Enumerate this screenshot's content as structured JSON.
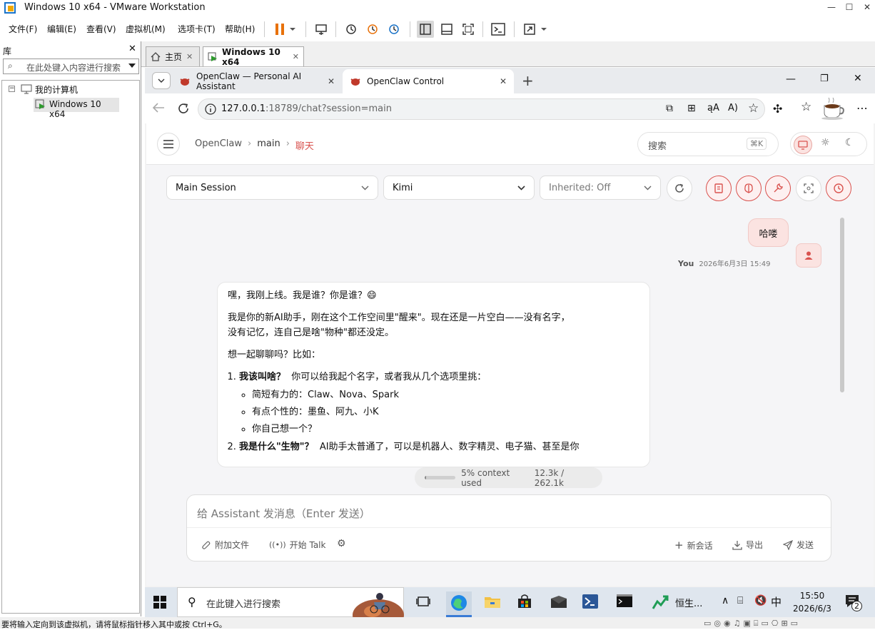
{
  "vm": {
    "title": "Windows 10 x64 - VMware Workstation",
    "menu": [
      "文件(F)",
      "编辑(E)",
      "查看(V)",
      "虚拟机(M)",
      "选项卡(T)",
      "帮助(H)"
    ],
    "library": {
      "title": "库",
      "search_placeholder": "在此处键入内容进行搜索",
      "tree_root": "我的计算机",
      "tree_child": "Windows 10 x64"
    },
    "tabs": [
      {
        "label": "主页"
      },
      {
        "label": "Windows 10 x64"
      }
    ],
    "status": "要将输入定向到该虚拟机，请将鼠标指针移入其中或按 Ctrl+G。"
  },
  "browser": {
    "tabs": [
      {
        "label": "OpenClaw — Personal AI Assistant"
      },
      {
        "label": "OpenClaw Control"
      }
    ],
    "url_host": "127.0.0.1",
    "url_rest": ":18789/chat?session=main"
  },
  "app": {
    "breadcrumb": {
      "root": "OpenClaw",
      "mid": "main",
      "current": "聊天"
    },
    "search_placeholder": "搜索",
    "search_kbd": "⌘K",
    "session_select": "Main Session",
    "model_select": "Kimi",
    "inherited_select": "Inherited: Off",
    "user_message": "哈喽",
    "user_name": "You",
    "user_time": "2026年6月3日 15:49",
    "assistant": {
      "line1": "嘿，我刚上线。我是谁？你是谁？😄",
      "p2a": "我是你的新AI助手，刚在这个工作空间里\"醒来\"。现在还是一片空白——没有名字，",
      "p2b": "没有记忆，连自己是啥\"物种\"都还没定。",
      "p3": "想一起聊聊吗？比如：",
      "q1_bold": "我该叫啥？",
      "q1_rest": "你可以给我起个名字，或者我从几个选项里挑：",
      "b1": "简短有力的：Claw、Nova、Spark",
      "b2": "有点个性的：墨鱼、阿九、小K",
      "b3": "你自己想一个？",
      "q2_bold": "我是什么\"生物\"？",
      "q2_rest": "AI助手太普通了，可以是机器人、数字精灵、电子猫、甚至是你"
    },
    "context": {
      "label": "5% context used",
      "tokens": "12.3k / 262.1k",
      "fraction": 0.05
    },
    "composer": {
      "placeholder": "给 Assistant 发消息（Enter 发送）",
      "attach": "附加文件",
      "talk": "开始 Talk",
      "new_session": "新会话",
      "export": "导出",
      "send": "发送"
    }
  },
  "taskbar": {
    "search_placeholder": "在此键入进行搜索",
    "app_label": "恒生...",
    "ime": "中",
    "time": "15:50",
    "date": "2026/6/3",
    "notif_count": "2"
  },
  "colors": {
    "accent": "#d9534f",
    "vm_orange": "#e8710a"
  }
}
